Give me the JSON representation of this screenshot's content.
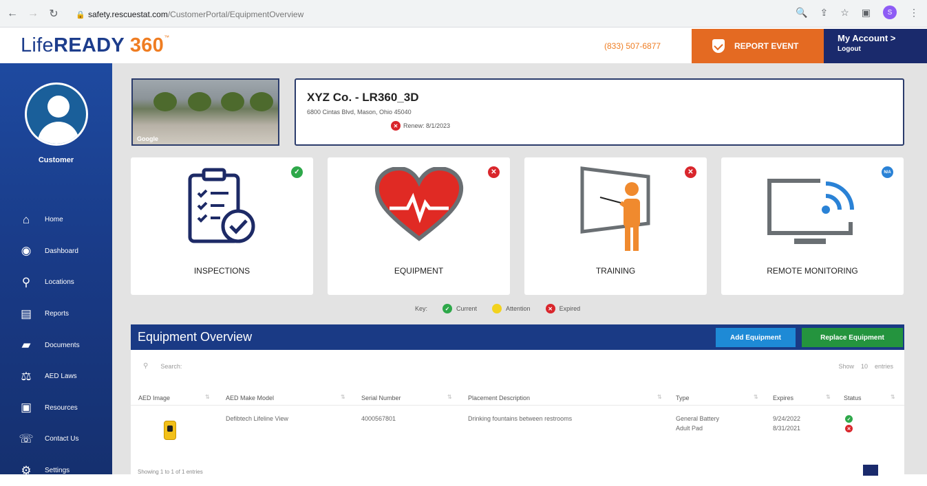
{
  "browser": {
    "url_domain": "safety.rescuestat.com",
    "url_path": "/CustomerPortal/EquipmentOverview",
    "profile_initial": "S"
  },
  "header": {
    "logo_life": "Life",
    "logo_ready": "READY ",
    "logo_num": "360",
    "logo_tm": "™",
    "phone": "(833) 507-6877",
    "report_label": "REPORT EVENT",
    "account_label": "My Account >",
    "logout_label": "Logout"
  },
  "sidebar": {
    "user_label": "Customer",
    "items": [
      {
        "label": "Home",
        "icon": "home-icon"
      },
      {
        "label": "Dashboard",
        "icon": "dashboard-icon"
      },
      {
        "label": "Locations",
        "icon": "location-pin-icon"
      },
      {
        "label": "Reports",
        "icon": "reports-icon"
      },
      {
        "label": "Documents",
        "icon": "folder-icon"
      },
      {
        "label": "AED Laws",
        "icon": "scales-icon"
      },
      {
        "label": "Resources",
        "icon": "resources-icon"
      },
      {
        "label": "Contact Us",
        "icon": "headset-icon"
      },
      {
        "label": "Settings",
        "icon": "gears-icon"
      }
    ]
  },
  "site": {
    "name": "XYZ Co. - LR360_3D",
    "address": "6800 Cintas Blvd, Mason, Ohio 45040",
    "renewal": "Renew: 8/1/2023",
    "photo_mark": "Google"
  },
  "tiles": [
    {
      "label": "INSPECTIONS",
      "status": "current"
    },
    {
      "label": "EQUIPMENT",
      "status": "expired"
    },
    {
      "label": "TRAINING",
      "status": "expired"
    },
    {
      "label": "REMOTE MONITORING",
      "status": "n/a"
    }
  ],
  "key": {
    "label": "Key:",
    "current": "Current",
    "attention": "Attention",
    "expired": "Expired"
  },
  "equipment": {
    "title": "Equipment Overview",
    "add_label": "Add Equipment",
    "replace_label": "Replace Equipment",
    "search_placeholder": "Search:",
    "show_label": "Show",
    "show_value": "10",
    "entries_label": "entries",
    "columns": [
      "AED Image",
      "AED Make Model",
      "Serial Number",
      "Placement Description",
      "Type",
      "Expires",
      "Status"
    ],
    "row": {
      "model": "Defibtech Lifeline View",
      "serial": "4000567801",
      "placement": "Drinking fountains between restrooms",
      "type1": "General Battery",
      "type2": "Adult Pad",
      "expires1": "9/24/2022",
      "expires2": "8/31/2021"
    },
    "footer_text": "Showing 1 to 1 of 1 entries"
  },
  "colors": {
    "navy": "#1a2a6c",
    "orange": "#ef7d22",
    "green": "#2ea84a",
    "red": "#d9262c",
    "blue": "#2a82d6"
  }
}
